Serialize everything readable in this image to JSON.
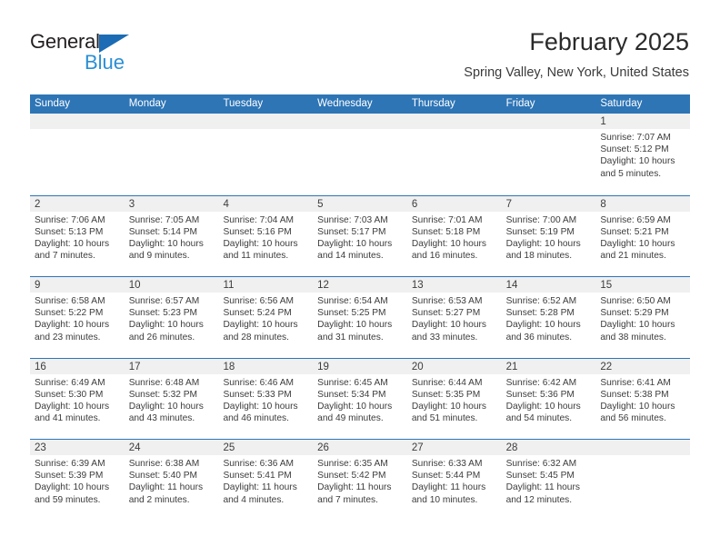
{
  "brand": {
    "name_part1": "General",
    "name_part2": "Blue",
    "triangle_color": "#1b6cb4",
    "blue_color": "#2a8fd4"
  },
  "header": {
    "title": "February 2025",
    "location": "Spring Valley, New York, United States"
  },
  "theme": {
    "header_blue": "#2e75b6",
    "daynum_band": "#f0f0f0",
    "text": "#3c3c3c"
  },
  "weekdays": [
    "Sunday",
    "Monday",
    "Tuesday",
    "Wednesday",
    "Thursday",
    "Friday",
    "Saturday"
  ],
  "weeks": [
    [
      {
        "day": "",
        "empty": true
      },
      {
        "day": "",
        "empty": true
      },
      {
        "day": "",
        "empty": true
      },
      {
        "day": "",
        "empty": true
      },
      {
        "day": "",
        "empty": true
      },
      {
        "day": "",
        "empty": true
      },
      {
        "day": "1",
        "sunrise": "Sunrise: 7:07 AM",
        "sunset": "Sunset: 5:12 PM",
        "daylight": "Daylight: 10 hours and 5 minutes."
      }
    ],
    [
      {
        "day": "2",
        "sunrise": "Sunrise: 7:06 AM",
        "sunset": "Sunset: 5:13 PM",
        "daylight": "Daylight: 10 hours and 7 minutes."
      },
      {
        "day": "3",
        "sunrise": "Sunrise: 7:05 AM",
        "sunset": "Sunset: 5:14 PM",
        "daylight": "Daylight: 10 hours and 9 minutes."
      },
      {
        "day": "4",
        "sunrise": "Sunrise: 7:04 AM",
        "sunset": "Sunset: 5:16 PM",
        "daylight": "Daylight: 10 hours and 11 minutes."
      },
      {
        "day": "5",
        "sunrise": "Sunrise: 7:03 AM",
        "sunset": "Sunset: 5:17 PM",
        "daylight": "Daylight: 10 hours and 14 minutes."
      },
      {
        "day": "6",
        "sunrise": "Sunrise: 7:01 AM",
        "sunset": "Sunset: 5:18 PM",
        "daylight": "Daylight: 10 hours and 16 minutes."
      },
      {
        "day": "7",
        "sunrise": "Sunrise: 7:00 AM",
        "sunset": "Sunset: 5:19 PM",
        "daylight": "Daylight: 10 hours and 18 minutes."
      },
      {
        "day": "8",
        "sunrise": "Sunrise: 6:59 AM",
        "sunset": "Sunset: 5:21 PM",
        "daylight": "Daylight: 10 hours and 21 minutes."
      }
    ],
    [
      {
        "day": "9",
        "sunrise": "Sunrise: 6:58 AM",
        "sunset": "Sunset: 5:22 PM",
        "daylight": "Daylight: 10 hours and 23 minutes."
      },
      {
        "day": "10",
        "sunrise": "Sunrise: 6:57 AM",
        "sunset": "Sunset: 5:23 PM",
        "daylight": "Daylight: 10 hours and 26 minutes."
      },
      {
        "day": "11",
        "sunrise": "Sunrise: 6:56 AM",
        "sunset": "Sunset: 5:24 PM",
        "daylight": "Daylight: 10 hours and 28 minutes."
      },
      {
        "day": "12",
        "sunrise": "Sunrise: 6:54 AM",
        "sunset": "Sunset: 5:25 PM",
        "daylight": "Daylight: 10 hours and 31 minutes."
      },
      {
        "day": "13",
        "sunrise": "Sunrise: 6:53 AM",
        "sunset": "Sunset: 5:27 PM",
        "daylight": "Daylight: 10 hours and 33 minutes."
      },
      {
        "day": "14",
        "sunrise": "Sunrise: 6:52 AM",
        "sunset": "Sunset: 5:28 PM",
        "daylight": "Daylight: 10 hours and 36 minutes."
      },
      {
        "day": "15",
        "sunrise": "Sunrise: 6:50 AM",
        "sunset": "Sunset: 5:29 PM",
        "daylight": "Daylight: 10 hours and 38 minutes."
      }
    ],
    [
      {
        "day": "16",
        "sunrise": "Sunrise: 6:49 AM",
        "sunset": "Sunset: 5:30 PM",
        "daylight": "Daylight: 10 hours and 41 minutes."
      },
      {
        "day": "17",
        "sunrise": "Sunrise: 6:48 AM",
        "sunset": "Sunset: 5:32 PM",
        "daylight": "Daylight: 10 hours and 43 minutes."
      },
      {
        "day": "18",
        "sunrise": "Sunrise: 6:46 AM",
        "sunset": "Sunset: 5:33 PM",
        "daylight": "Daylight: 10 hours and 46 minutes."
      },
      {
        "day": "19",
        "sunrise": "Sunrise: 6:45 AM",
        "sunset": "Sunset: 5:34 PM",
        "daylight": "Daylight: 10 hours and 49 minutes."
      },
      {
        "day": "20",
        "sunrise": "Sunrise: 6:44 AM",
        "sunset": "Sunset: 5:35 PM",
        "daylight": "Daylight: 10 hours and 51 minutes."
      },
      {
        "day": "21",
        "sunrise": "Sunrise: 6:42 AM",
        "sunset": "Sunset: 5:36 PM",
        "daylight": "Daylight: 10 hours and 54 minutes."
      },
      {
        "day": "22",
        "sunrise": "Sunrise: 6:41 AM",
        "sunset": "Sunset: 5:38 PM",
        "daylight": "Daylight: 10 hours and 56 minutes."
      }
    ],
    [
      {
        "day": "23",
        "sunrise": "Sunrise: 6:39 AM",
        "sunset": "Sunset: 5:39 PM",
        "daylight": "Daylight: 10 hours and 59 minutes."
      },
      {
        "day": "24",
        "sunrise": "Sunrise: 6:38 AM",
        "sunset": "Sunset: 5:40 PM",
        "daylight": "Daylight: 11 hours and 2 minutes."
      },
      {
        "day": "25",
        "sunrise": "Sunrise: 6:36 AM",
        "sunset": "Sunset: 5:41 PM",
        "daylight": "Daylight: 11 hours and 4 minutes."
      },
      {
        "day": "26",
        "sunrise": "Sunrise: 6:35 AM",
        "sunset": "Sunset: 5:42 PM",
        "daylight": "Daylight: 11 hours and 7 minutes."
      },
      {
        "day": "27",
        "sunrise": "Sunrise: 6:33 AM",
        "sunset": "Sunset: 5:44 PM",
        "daylight": "Daylight: 11 hours and 10 minutes."
      },
      {
        "day": "28",
        "sunrise": "Sunrise: 6:32 AM",
        "sunset": "Sunset: 5:45 PM",
        "daylight": "Daylight: 11 hours and 12 minutes."
      },
      {
        "day": "",
        "empty": true
      }
    ]
  ]
}
